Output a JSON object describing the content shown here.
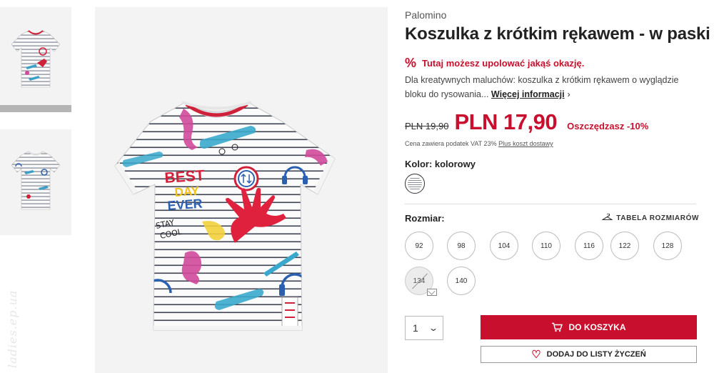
{
  "gallery": {
    "watermark": "ladies.ep.ua",
    "print_text": [
      "BEST",
      "DAY",
      "EVER"
    ],
    "stay_cool_text": [
      "STAY",
      "COOL"
    ]
  },
  "product": {
    "brand": "Palomino",
    "title": "Koszulka z krótkim rękawem - w paski",
    "deal_icon": "%",
    "deal_text": "Tutaj możesz upolować jakąś okazję.",
    "description": "Dla kreatywnych maluchów: koszulka z krótkim rękawem o wyglądzie bloku do rysowania...",
    "more_info_label": "Więcej informacji",
    "old_price": "PLN 19,90",
    "new_price": "PLN 17,90",
    "savings": "Oszczędzasz -10%",
    "vat_text": "Cena zawiera podatek VAT 23%",
    "shipping_link": "Plus koszt dostawy"
  },
  "color": {
    "label": "Kolor: kolorowy"
  },
  "size": {
    "label": "Rozmiar:",
    "table_label": "TABELA ROZMIARÓW",
    "options": [
      {
        "value": "92",
        "available": true
      },
      {
        "value": "98",
        "available": true
      },
      {
        "value": "104",
        "available": true
      },
      {
        "value": "110",
        "available": true
      },
      {
        "value": "116",
        "available": true
      },
      {
        "value": "122",
        "available": true
      },
      {
        "value": "128",
        "available": true
      },
      {
        "value": "134",
        "available": false
      },
      {
        "value": "140",
        "available": true
      }
    ]
  },
  "cart": {
    "quantity": "1",
    "add_to_cart_label": "DO KOSZYKA",
    "wishlist_label": "DODAJ DO LISTY ŻYCZEŃ"
  },
  "colors": {
    "accent": "#c8102e",
    "text": "#222222"
  }
}
